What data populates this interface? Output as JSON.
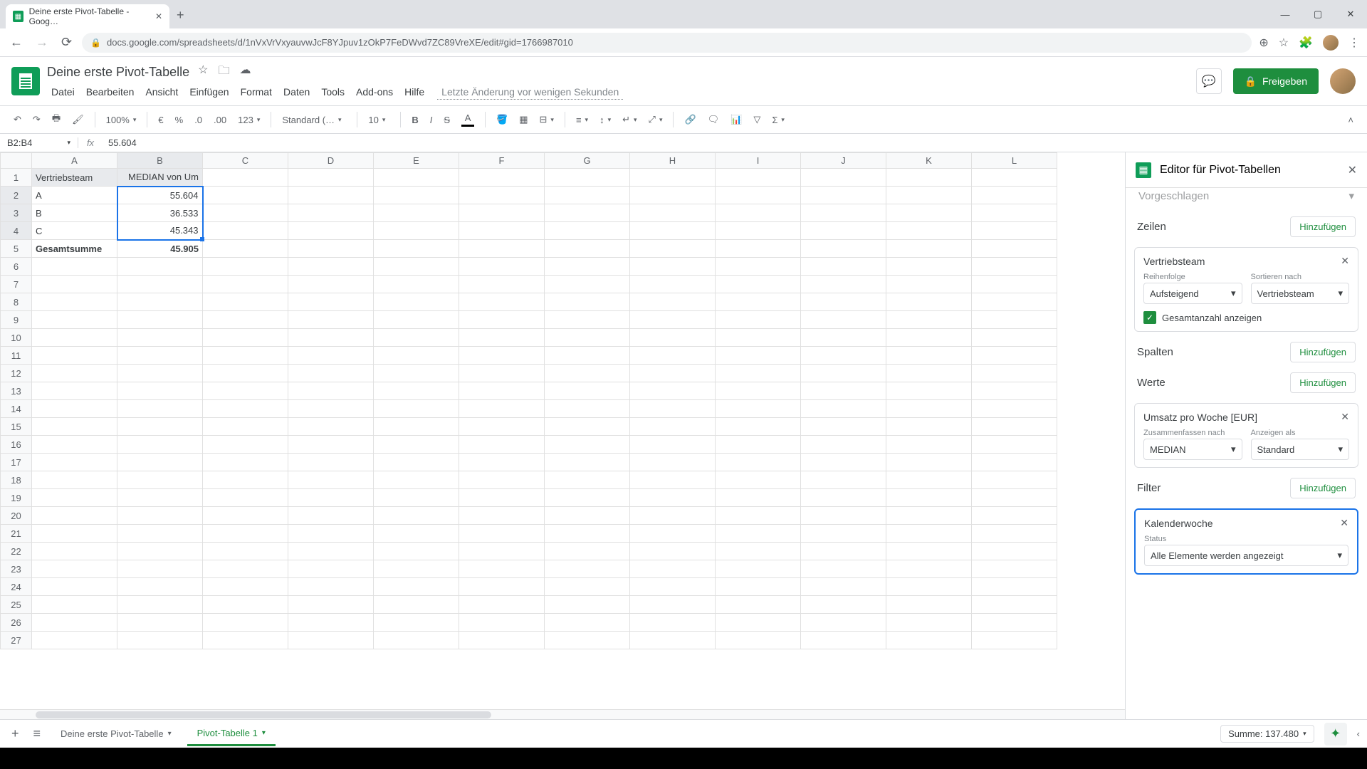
{
  "browser": {
    "tab_title": "Deine erste Pivot-Tabelle - Goog…",
    "url": "docs.google.com/spreadsheets/d/1nVxVrVxyauvwJcF8YJpuv1zOkP7FeDWvd7ZC89VreXE/edit#gid=1766987010"
  },
  "doc": {
    "title": "Deine erste Pivot-Tabelle",
    "menus": [
      "Datei",
      "Bearbeiten",
      "Ansicht",
      "Einfügen",
      "Format",
      "Daten",
      "Tools",
      "Add-ons",
      "Hilfe"
    ],
    "last_edit": "Letzte Änderung vor wenigen Sekunden",
    "share_label": "Freigeben"
  },
  "toolbar": {
    "zoom": "100%",
    "number_fmt": "123",
    "font": "Standard (…",
    "font_size": "10"
  },
  "formula": {
    "name_box": "B2:B4",
    "value": "55.604"
  },
  "columns": [
    "A",
    "B",
    "C",
    "D",
    "E",
    "F",
    "G",
    "H",
    "I",
    "J",
    "K",
    "L"
  ],
  "rows": {
    "headers": {
      "A": "Vertriebsteam",
      "B": "MEDIAN von Um"
    },
    "data": [
      {
        "A": "A",
        "B": "55.604"
      },
      {
        "A": "B",
        "B": "36.533"
      },
      {
        "A": "C",
        "B": "45.343"
      }
    ],
    "total": {
      "A": "Gesamtsumme",
      "B": "45.905"
    }
  },
  "sidebar": {
    "title": "Editor für Pivot-Tabellen",
    "suggested": "Vorgeschlagen",
    "sections": {
      "rows": {
        "title": "Zeilen",
        "add": "Hinzufügen"
      },
      "cols": {
        "title": "Spalten",
        "add": "Hinzufügen"
      },
      "vals": {
        "title": "Werte",
        "add": "Hinzufügen"
      },
      "filter": {
        "title": "Filter",
        "add": "Hinzufügen"
      }
    },
    "row_card": {
      "title": "Vertriebsteam",
      "order_label": "Reihenfolge",
      "order_value": "Aufsteigend",
      "sort_label": "Sortieren nach",
      "sort_value": "Vertriebsteam",
      "show_total": "Gesamtanzahl anzeigen"
    },
    "val_card": {
      "title": "Umsatz pro Woche [EUR]",
      "summarize_label": "Zusammenfassen nach",
      "summarize_value": "MEDIAN",
      "show_as_label": "Anzeigen als",
      "show_as_value": "Standard"
    },
    "filter_card": {
      "title": "Kalenderwoche",
      "status_label": "Status",
      "status_value": "Alle Elemente werden angezeigt"
    }
  },
  "sheet_tabs": {
    "tab1": "Deine erste Pivot-Tabelle",
    "tab2": "Pivot-Tabelle 1",
    "summary": "Summe: 137.480"
  }
}
